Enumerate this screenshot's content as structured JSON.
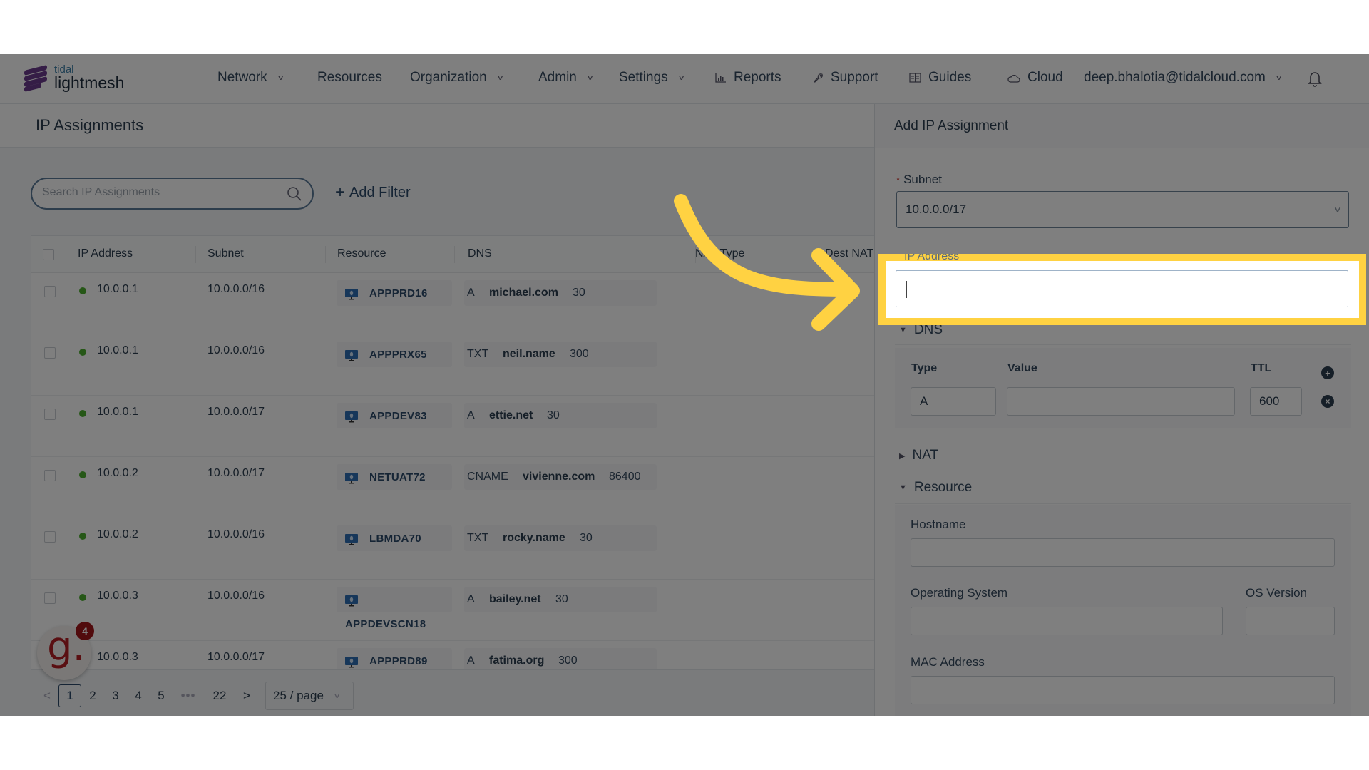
{
  "nav": {
    "logo_top": "tidal",
    "logo_bottom": "lightmesh",
    "items": [
      {
        "label": "Network",
        "dropdown": true
      },
      {
        "label": "Resources",
        "dropdown": false
      },
      {
        "label": "Organization",
        "dropdown": true
      },
      {
        "label": "Admin",
        "dropdown": true
      },
      {
        "label": "Settings",
        "dropdown": true
      },
      {
        "label": "Reports",
        "icon": "bar-chart-icon"
      },
      {
        "label": "Support",
        "icon": "wrench-icon"
      },
      {
        "label": "Guides",
        "icon": "book-icon"
      },
      {
        "label": "Cloud",
        "icon": "cloud-icon"
      }
    ],
    "user_email": "deep.bhalotia@tidalcloud.com",
    "chevron": "v"
  },
  "page": {
    "title": "IP Assignments",
    "search_placeholder": "Search IP Assignments",
    "add_filter_label": "Add Filter",
    "add_filter_icon": "+"
  },
  "table": {
    "columns": [
      "IP Address",
      "Subnet",
      "Resource",
      "DNS",
      "NAT Type",
      "Dest NAT"
    ],
    "rows": [
      {
        "ip": "10.0.0.1",
        "subnet": "10.0.0.0/16",
        "resource": "APPPRD16",
        "dns_type": "A",
        "dns_value": "michael.com",
        "ttl": "30"
      },
      {
        "ip": "10.0.0.1",
        "subnet": "10.0.0.0/16",
        "resource": "APPPRX65",
        "dns_type": "TXT",
        "dns_value": "neil.name",
        "ttl": "300"
      },
      {
        "ip": "10.0.0.1",
        "subnet": "10.0.0.0/17",
        "resource": "APPDEV83",
        "dns_type": "A",
        "dns_value": "ettie.net",
        "ttl": "30"
      },
      {
        "ip": "10.0.0.2",
        "subnet": "10.0.0.0/17",
        "resource": "NETUAT72",
        "dns_type": "CNAME",
        "dns_value": "vivienne.com",
        "ttl": "86400"
      },
      {
        "ip": "10.0.0.2",
        "subnet": "10.0.0.0/16",
        "resource": "LBMDA70",
        "dns_type": "TXT",
        "dns_value": "rocky.name",
        "ttl": "30"
      },
      {
        "ip": "10.0.0.3",
        "subnet": "10.0.0.0/16",
        "resource": "APPDEVSCN18",
        "dns_type": "A",
        "dns_value": "bailey.net",
        "ttl": "30"
      },
      {
        "ip": "10.0.0.3",
        "subnet": "10.0.0.0/17",
        "resource": "APPPRD89",
        "dns_type": "A",
        "dns_value": "fatima.org",
        "ttl": "300"
      }
    ]
  },
  "pagination": {
    "prev": "<",
    "pages": [
      "1",
      "2",
      "3",
      "4",
      "5"
    ],
    "ellipsis": "•••",
    "last": "22",
    "next": ">",
    "current": "1",
    "page_size": "25 / page"
  },
  "guide_widget": {
    "letter": "g.",
    "count": "4"
  },
  "panel": {
    "title": "Add IP Assignment",
    "subnet_label": "Subnet",
    "subnet_required": "*",
    "subnet_value": "10.0.0.0/17",
    "ip_label": "IP Address",
    "ip_value": "",
    "dns_section": "DNS",
    "dns_type_label": "Type",
    "dns_value_label": "Value",
    "dns_ttl_label": "TTL",
    "dns_type_value": "A",
    "dns_value_value": "",
    "dns_ttl_value": "600",
    "add_icon": "+",
    "remove_icon": "×",
    "nat_section": "NAT",
    "resource_section": "Resource",
    "hostname_label": "Hostname",
    "os_label": "Operating System",
    "os_version_label": "OS Version",
    "mac_label": "MAC Address"
  },
  "annotation": {
    "highlight_color": "#ffd242",
    "arrow_color": "#ffd242"
  }
}
